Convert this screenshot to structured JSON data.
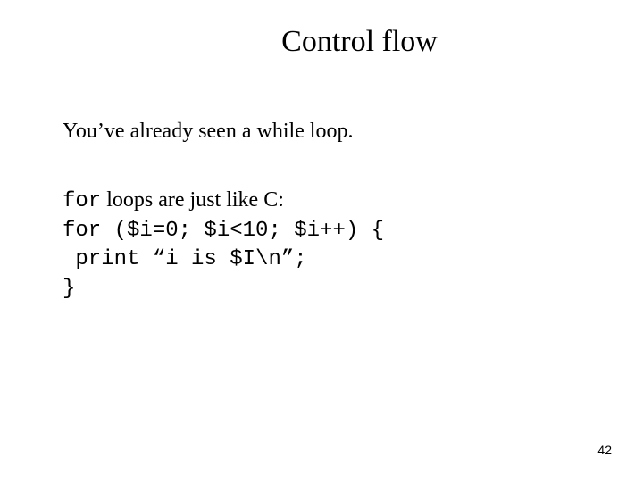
{
  "slide": {
    "title": "Control flow",
    "line1": "You’ve already seen a while loop.",
    "line2_mono": "for",
    "line2_rest": " loops are just like C:",
    "code_line1": "for ($i=0; $i<10; $i++) {",
    "code_line2": " print “i is $I\\n”;",
    "code_line3": "}",
    "page_number": "42"
  }
}
